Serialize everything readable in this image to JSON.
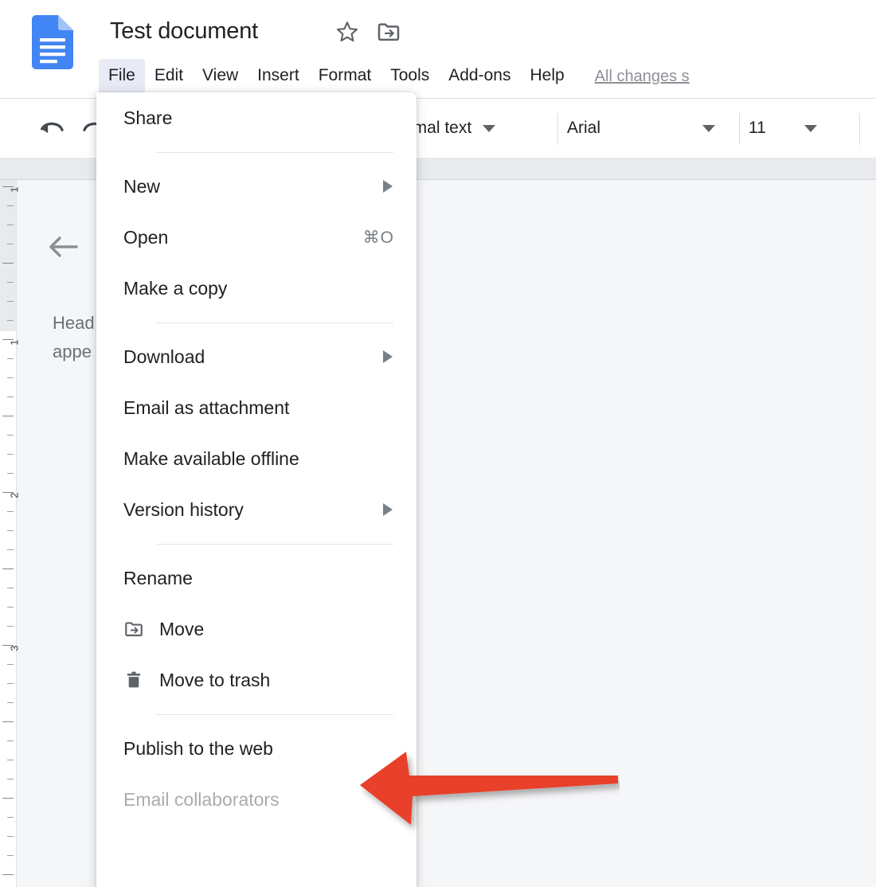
{
  "app": {
    "name": "Google Docs",
    "logo_icon": "google-docs-icon",
    "brand_color": "#4285f4"
  },
  "header": {
    "title": "Test document",
    "star_icon": "star-icon",
    "move_to_folder_icon": "move-to-folder-icon"
  },
  "menubar": {
    "items": [
      {
        "label": "File",
        "active": true
      },
      {
        "label": "Edit",
        "active": false
      },
      {
        "label": "View",
        "active": false
      },
      {
        "label": "Insert",
        "active": false
      },
      {
        "label": "Format",
        "active": false
      },
      {
        "label": "Tools",
        "active": false
      },
      {
        "label": "Add-ons",
        "active": false
      },
      {
        "label": "Help",
        "active": false
      }
    ],
    "save_status": "All changes s",
    "active_highlight_color": "#e8eaf6"
  },
  "toolbar": {
    "undo_icon": "undo-icon",
    "redo_icon": "redo-icon",
    "paragraph_style": "ormal text",
    "font_family": "Arial",
    "font_size": "11",
    "caret_icon": "chevron-down-icon"
  },
  "file_menu": {
    "items": [
      {
        "label": "Share",
        "icon": null,
        "shortcut": null,
        "submenu": false,
        "disabled": false,
        "divider_after": true
      },
      {
        "label": "New",
        "icon": null,
        "shortcut": null,
        "submenu": true,
        "disabled": false,
        "divider_after": false
      },
      {
        "label": "Open",
        "icon": null,
        "shortcut": "⌘O",
        "submenu": false,
        "disabled": false,
        "divider_after": false
      },
      {
        "label": "Make a copy",
        "icon": null,
        "shortcut": null,
        "submenu": false,
        "disabled": false,
        "divider_after": true
      },
      {
        "label": "Download",
        "icon": null,
        "shortcut": null,
        "submenu": true,
        "disabled": false,
        "divider_after": false
      },
      {
        "label": "Email as attachment",
        "icon": null,
        "shortcut": null,
        "submenu": false,
        "disabled": false,
        "divider_after": false
      },
      {
        "label": "Make available offline",
        "icon": null,
        "shortcut": null,
        "submenu": false,
        "disabled": false,
        "divider_after": false
      },
      {
        "label": "Version history",
        "icon": null,
        "shortcut": null,
        "submenu": true,
        "disabled": false,
        "divider_after": true
      },
      {
        "label": "Rename",
        "icon": null,
        "shortcut": null,
        "submenu": false,
        "disabled": false,
        "divider_after": false
      },
      {
        "label": "Move",
        "icon": "move-to-folder-icon",
        "shortcut": null,
        "submenu": false,
        "disabled": false,
        "divider_after": false
      },
      {
        "label": "Move to trash",
        "icon": "trash-icon",
        "shortcut": null,
        "submenu": false,
        "disabled": false,
        "divider_after": true
      },
      {
        "label": "Publish to the web",
        "icon": null,
        "shortcut": null,
        "submenu": false,
        "disabled": false,
        "divider_after": false
      },
      {
        "label": "Email collaborators",
        "icon": null,
        "shortcut": null,
        "submenu": false,
        "disabled": true,
        "divider_after": false
      }
    ]
  },
  "document": {
    "back_arrow_icon": "back-arrow-icon",
    "body_line1": "Head",
    "body_line2": "appe"
  },
  "ruler": {
    "numbers": [
      "1",
      "1",
      "2",
      "3"
    ],
    "orientation": "vertical"
  },
  "annotation": {
    "arrow_icon": "red-pointer-arrow-icon",
    "arrow_color": "#e8412a",
    "points_at": "Publish to the web"
  }
}
